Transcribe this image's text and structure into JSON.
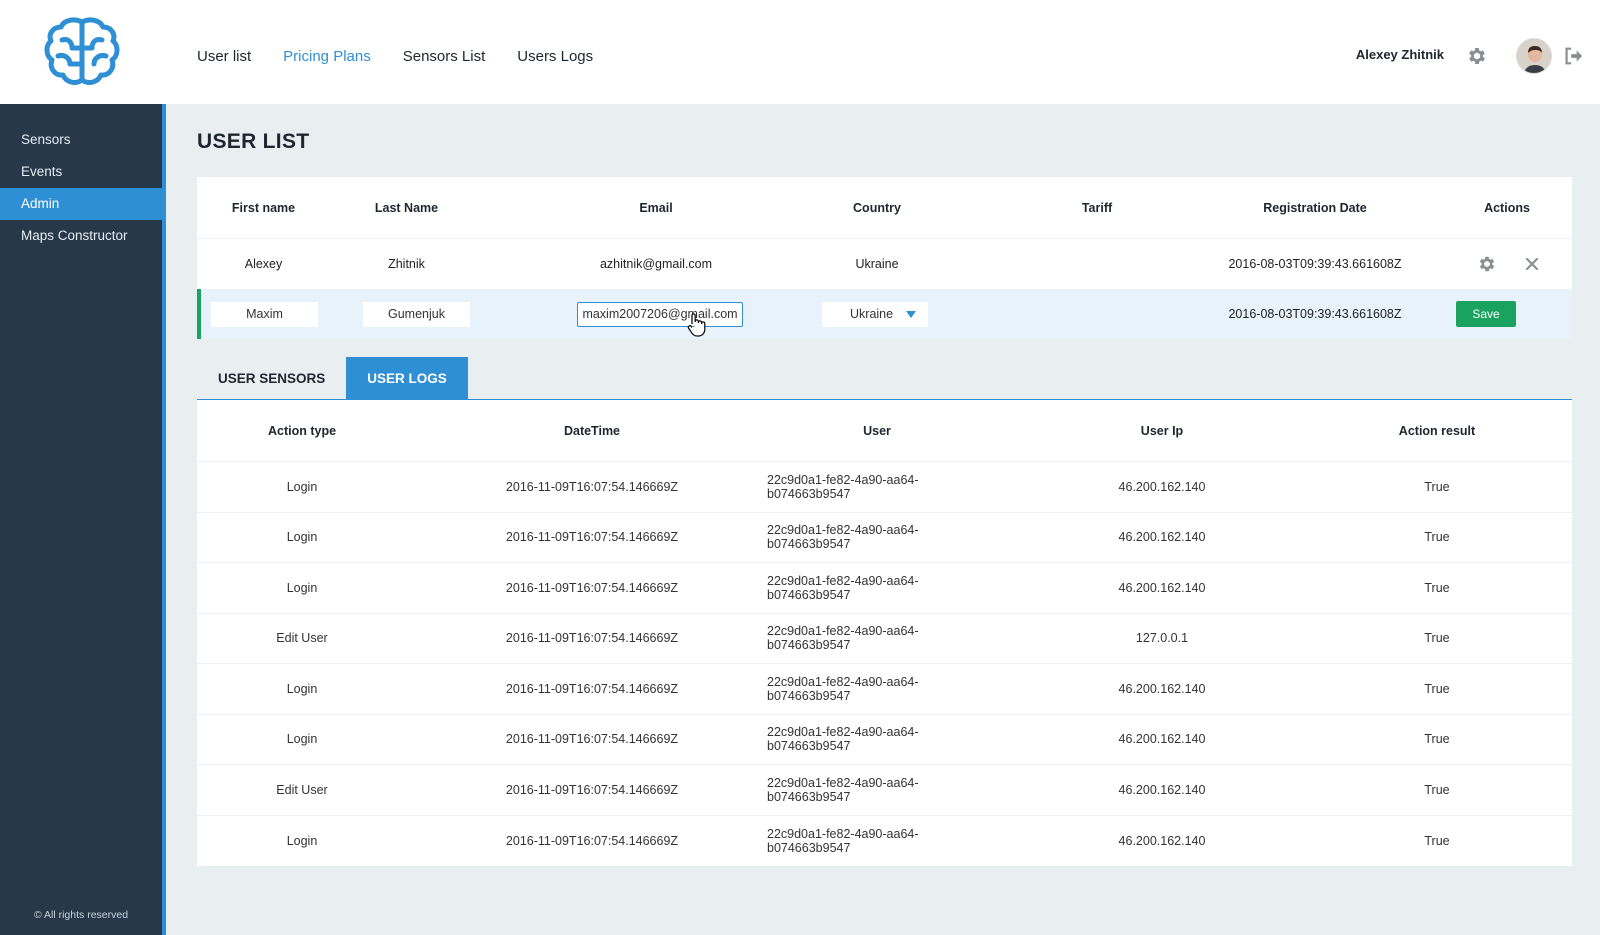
{
  "brand": {
    "logo_icon": "brain-icon",
    "accent": "#2f8fd4",
    "success": "#1aa260",
    "sidebar_bg": "#27384a"
  },
  "topnav": [
    {
      "label": "User list",
      "active": false
    },
    {
      "label": "Pricing Plans",
      "active": true
    },
    {
      "label": "Sensors List",
      "active": false
    },
    {
      "label": "Users Logs",
      "active": false
    }
  ],
  "user": {
    "name": "Alexey Zhitnik",
    "settings_icon": "gear-icon",
    "logout_icon": "logout-icon"
  },
  "sidebar": {
    "items": [
      {
        "label": "Sensors",
        "active": false
      },
      {
        "label": "Events",
        "active": false
      },
      {
        "label": "Admin",
        "active": true
      },
      {
        "label": "Maps Constructor",
        "active": false
      }
    ],
    "footer": "© All rights reserved"
  },
  "page": {
    "title": "USER LIST"
  },
  "users_table": {
    "columns": [
      "First name",
      "Last Name",
      "Email",
      "Country",
      "Tariff",
      "Registration Date",
      "Actions"
    ],
    "rows": [
      {
        "first_name": "Alexey",
        "last_name": "Zhitnik",
        "email": "azhitnik@gmail.com",
        "country": "Ukraine",
        "tariff": "",
        "registration_date": "2016-08-03T09:39:43.661608Z"
      }
    ],
    "editing_row": {
      "first_name": "Maxim",
      "last_name": "Gumenjuk",
      "email": "maxim2007206@gmail.com",
      "country": "Ukraine",
      "registration_date": "2016-08-03T09:39:43.661608Z",
      "save_label": "Save"
    }
  },
  "tabs": [
    {
      "label": "USER SENSORS",
      "active": false
    },
    {
      "label": "USER LOGS",
      "active": true
    }
  ],
  "logs_table": {
    "columns": [
      "Action type",
      "DateTime",
      "User",
      "User Ip",
      "Action result"
    ],
    "rows": [
      [
        "Login",
        "2016-11-09T16:07:54.146669Z",
        "22c9d0a1-fe82-4a90-aa64-b074663b9547",
        "46.200.162.140",
        "True"
      ],
      [
        "Login",
        "2016-11-09T16:07:54.146669Z",
        "22c9d0a1-fe82-4a90-aa64-b074663b9547",
        "46.200.162.140",
        "True"
      ],
      [
        "Login",
        "2016-11-09T16:07:54.146669Z",
        "22c9d0a1-fe82-4a90-aa64-b074663b9547",
        "46.200.162.140",
        "True"
      ],
      [
        "Edit User",
        "2016-11-09T16:07:54.146669Z",
        "22c9d0a1-fe82-4a90-aa64-b074663b9547",
        "127.0.0.1",
        "True"
      ],
      [
        "Login",
        "2016-11-09T16:07:54.146669Z",
        "22c9d0a1-fe82-4a90-aa64-b074663b9547",
        "46.200.162.140",
        "True"
      ],
      [
        "Login",
        "2016-11-09T16:07:54.146669Z",
        "22c9d0a1-fe82-4a90-aa64-b074663b9547",
        "46.200.162.140",
        "True"
      ],
      [
        "Edit User",
        "2016-11-09T16:07:54.146669Z",
        "22c9d0a1-fe82-4a90-aa64-b074663b9547",
        "46.200.162.140",
        "True"
      ],
      [
        "Login",
        "2016-11-09T16:07:54.146669Z",
        "22c9d0a1-fe82-4a90-aa64-b074663b9547",
        "46.200.162.140",
        "True"
      ]
    ]
  }
}
